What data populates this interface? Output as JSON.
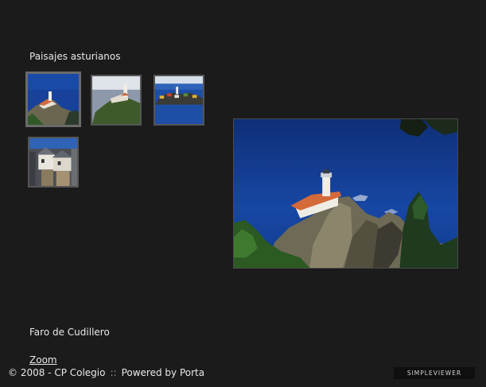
{
  "gallery": {
    "title": "Paisajes asturianos",
    "thumbnails": [
      {
        "id": "faro-cudillero",
        "selected": true
      },
      {
        "id": "faro-costa"
      },
      {
        "id": "espigon-puerto"
      },
      {
        "id": "casas-cudillero"
      }
    ]
  },
  "main_image": {
    "caption": "Faro de Cudillero"
  },
  "zoom_label": "Zoom",
  "footer": {
    "copyright": "© 2008 - CP Colegio",
    "separator": "::",
    "powered_by": "Powered by Porta"
  },
  "badge": "SIMPLEVIEWER",
  "colors": {
    "background": "#1b1b1b",
    "text": "#e8e8e8",
    "sea": "#123a8a"
  }
}
